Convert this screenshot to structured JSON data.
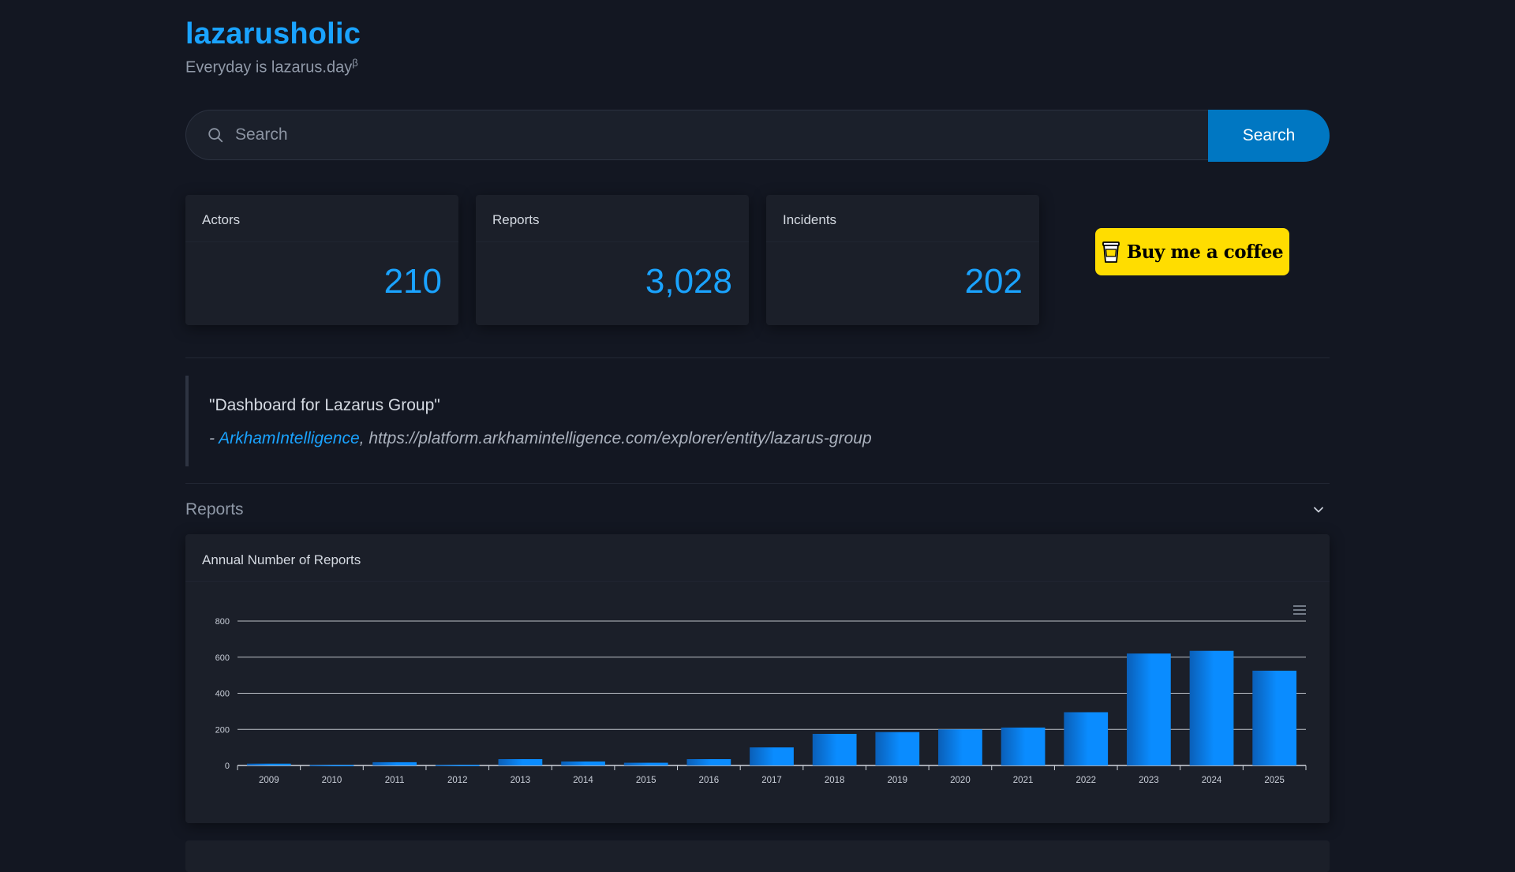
{
  "site": {
    "title": "lazarusholic",
    "tagline": "Everyday is lazarus.day",
    "tagline_sup": "β"
  },
  "search": {
    "placeholder": "Search",
    "button_label": "Search"
  },
  "stats": [
    {
      "label": "Actors",
      "value": "210"
    },
    {
      "label": "Reports",
      "value": "3,028"
    },
    {
      "label": "Incidents",
      "value": "202"
    }
  ],
  "donate": {
    "label": "Buy me a coffee",
    "icon": "coffee-cup-icon"
  },
  "quote": {
    "text": "\"Dashboard for Lazarus Group\"",
    "dash": "- ",
    "author": "ArkhamIntelligence",
    "separator": ", ",
    "url": "https://platform.arkhamintelligence.com/explorer/entity/lazarus-group"
  },
  "section": {
    "title": "Reports",
    "toggle_icon": "chevron-down-icon"
  },
  "colors": {
    "accent": "#1aa3ff",
    "bar": "#0a8cff",
    "button": "#0077c2",
    "donate": "#ffdd00",
    "background": "#131722"
  },
  "chart_data": {
    "type": "bar",
    "title": "Annual Number of Reports",
    "categories": [
      "2009",
      "2010",
      "2011",
      "2012",
      "2013",
      "2014",
      "2015",
      "2016",
      "2017",
      "2018",
      "2019",
      "2020",
      "2021",
      "2022",
      "2023",
      "2024",
      "2025"
    ],
    "values": [
      10,
      2,
      18,
      3,
      35,
      22,
      15,
      35,
      100,
      175,
      185,
      200,
      210,
      295,
      620,
      635,
      525
    ],
    "yticks": [
      "0",
      "200",
      "400",
      "600",
      "800"
    ],
    "ylim": [
      0,
      800
    ],
    "grid": true,
    "menu_icon": "hamburger-menu-icon"
  }
}
